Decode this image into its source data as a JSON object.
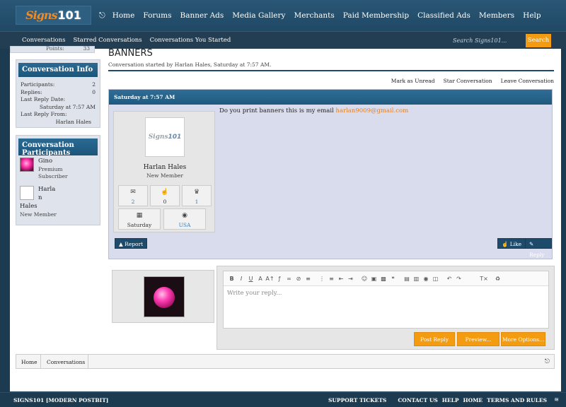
{
  "site": {
    "logo_text_a": "Signs",
    "logo_text_b": "101",
    "main_nav": [
      "Home",
      "Forums",
      "Banner Ads",
      "Media Gallery",
      "Merchants",
      "Paid Membership",
      "Classified Ads",
      "Members",
      "Help"
    ],
    "sub_nav": [
      "Conversations",
      "Starred Conversations",
      "Conversations You Started"
    ],
    "search_placeholder": "Search Signs101...",
    "search_button": "Search",
    "accent": "#f39c12",
    "nav_bg": "#1f4965"
  },
  "sidebar": {
    "partial_label": "Points:",
    "partial_value": "33",
    "info": {
      "title": "Conversation Info",
      "participants_label": "Participants:",
      "participants_value": "2",
      "replies_label": "Replies:",
      "replies_value": "0",
      "last_date_label": "Last Reply Date:",
      "last_date_value": "Saturday at 7:57 AM",
      "last_from_label": "Last Reply From:",
      "last_from_value": "Harlan Hales"
    },
    "participants": {
      "title": "Conversation Participants",
      "p1_name": "Gino",
      "p1_role_a": "Premium",
      "p1_role_b": "Subscriber",
      "p2_name_a": "Harla",
      "p2_name_b": "n",
      "p2_name_c": "Hales",
      "p2_role": "New Member"
    }
  },
  "thread": {
    "title": "BANNERS",
    "subtitle": "Conversation started by Harlan Hales, Saturday at 7:57 AM.",
    "actions": [
      "Mark as Unread",
      "Star Conversation",
      "Leave Conversation"
    ]
  },
  "message": {
    "header_date": "Saturday at 7:57 AM",
    "author_name": "Harlan Hales",
    "author_rank": "New Member",
    "stats": {
      "messages": "2",
      "likes": "0",
      "trophies": "1",
      "joined": "Saturday",
      "location": "USA"
    },
    "text": "Do you print banners this is my email",
    "email": "harlan9009@gmail.com",
    "report": "Report",
    "like": "Like",
    "reply": "Reply"
  },
  "composer": {
    "placeholder": "Write your reply...",
    "post_reply": "Post Reply",
    "preview": "Preview...",
    "more_options": "More Options..."
  },
  "breadcrumb": [
    "Home",
    "Conversations"
  ],
  "footer": {
    "left": "SIGNS101 [MODERN POSTBIT]",
    "links": [
      "SUPPORT TICKETS",
      "CONTACT US",
      "HELP",
      "HOME",
      "TERMS AND RULES"
    ]
  }
}
